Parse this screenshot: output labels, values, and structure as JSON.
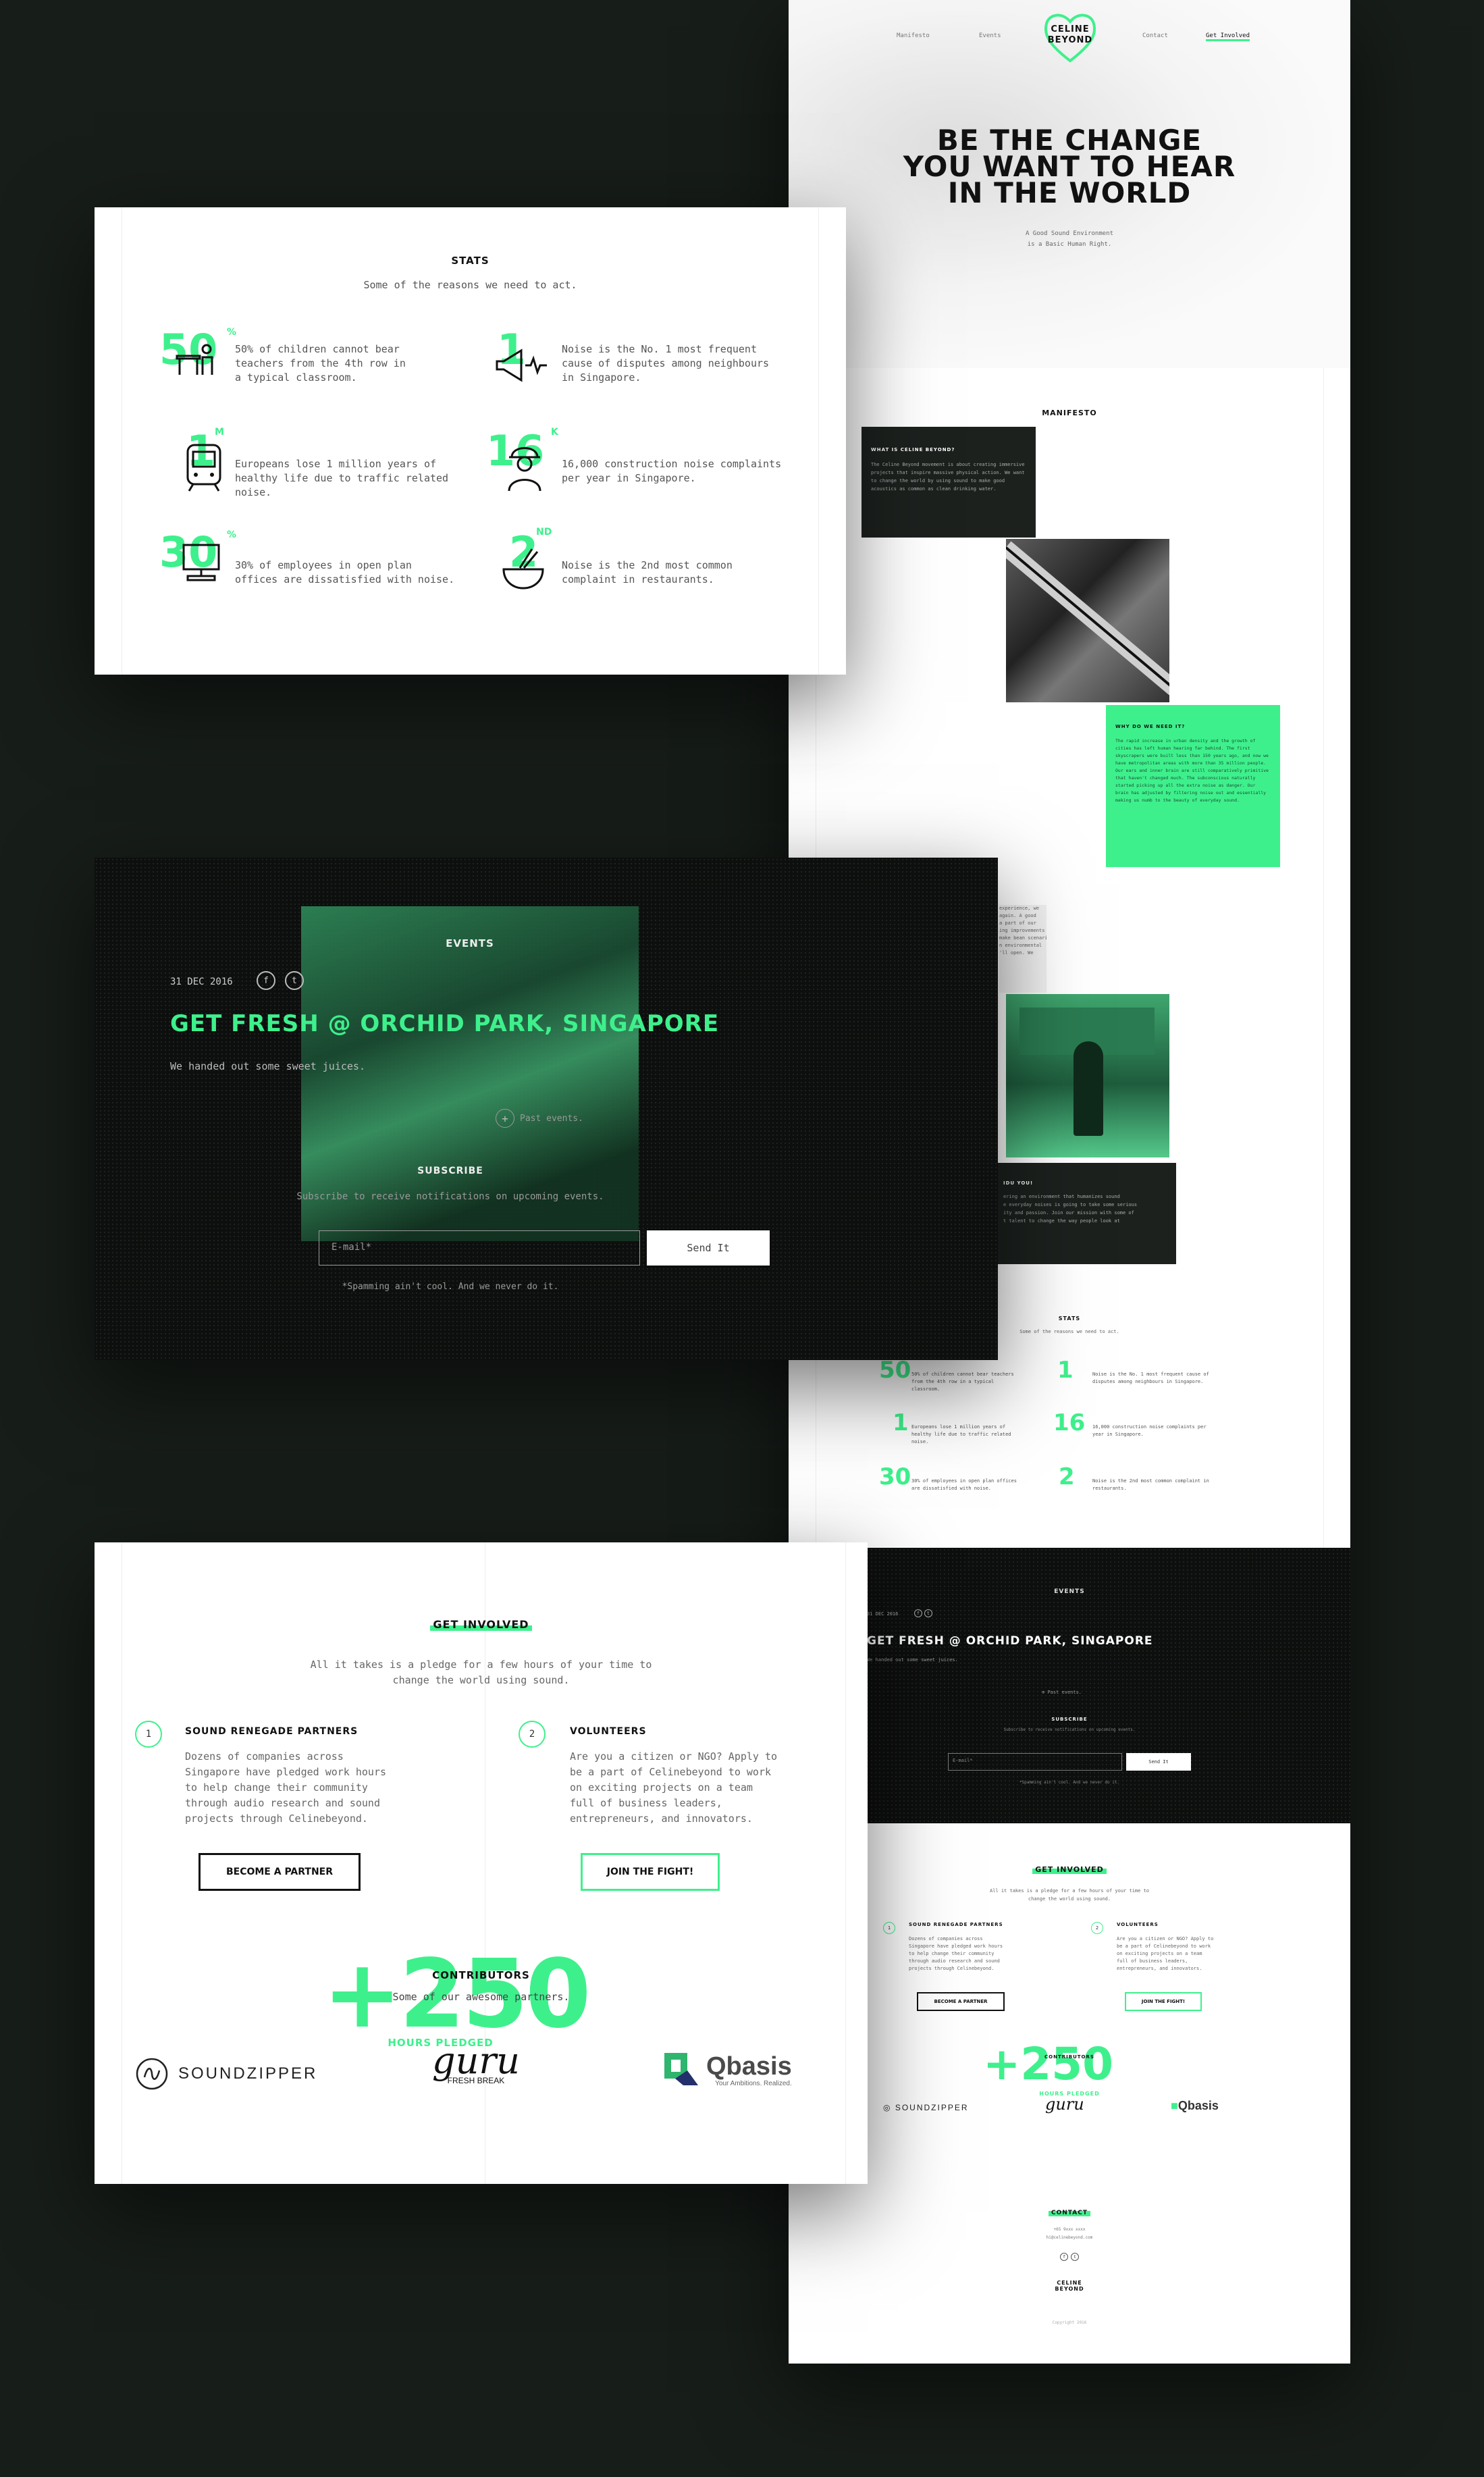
{
  "nav": {
    "links": [
      "Manifesto",
      "Events",
      "Contact",
      "Get Involved"
    ],
    "logo_line1": "CELINE",
    "logo_line2": "BEYOND"
  },
  "hero": {
    "title_lines": [
      "BE THE CHANGE",
      "YOU WANT TO HEAR",
      "IN THE WORLD"
    ],
    "subtitle_lines": [
      "A Good Sound Environment",
      "is a Basic Human Right."
    ]
  },
  "manifesto": {
    "title": "MANIFESTO",
    "what_title": "WHAT IS CELINE BEYOND?",
    "what_body": "The Celine Beyond movement is about creating immersive projects that inspire massive physical action. We want to change the world by using sound to make good acoustics as common as clean drinking water.",
    "why_title": "WHY DO WE NEED IT?",
    "why_body": "The rapid increase in urban density and the growth of cities has left human hearing far behind. The first skyscrapers were built less than 150 years ago, and now we have metropolitan areas with more than 35 million people. Our ears and inner brain are still comparatively primitive that haven't changed much. The subconscious naturally started picking up all the extra noise as danger. Our brain has adjusted by filtering noise out and essentially making us numb to the beauty of everyday sound.",
    "partial_body": "experience, we\nagain. A good\na part of our\ning improvements\nmake bean scenarios\nn environmental\n'll open. We",
    "you_title": "IDU YOU!",
    "you_body": "ering an environment that humanizes sound\ne everyday noises is going to take some serious\nity and passion. Join our mission with some of\nt talent to change the way people look at"
  },
  "stats": {
    "title": "STATS",
    "subtitle": "Some of the reasons we need to act.",
    "items": [
      {
        "num": "50",
        "sup": "%",
        "text": "50% of children cannot bear teachers from the 4th row in a typical classroom."
      },
      {
        "num": "1",
        "sup": "",
        "text": "Noise is the No. 1 most frequent cause of disputes among neighbours in Singapore."
      },
      {
        "num": "1",
        "sup": "M",
        "text": "Europeans lose 1 million years of healthy life due to traffic related noise."
      },
      {
        "num": "16",
        "sup": "K",
        "text": "16,000 construction noise complaints per year in Singapore."
      },
      {
        "num": "30",
        "sup": "%",
        "text": "30% of employees in open plan offices are dissatisfied with noise."
      },
      {
        "num": "2",
        "sup": "ND",
        "text": "Noise is the 2nd most common complaint in restaurants."
      }
    ]
  },
  "events": {
    "title": "EVENTS",
    "date": "31 DEC 2016",
    "headline": "GET FRESH @ ORCHID PARK, SINGAPORE",
    "desc": "We handed out some sweet juices.",
    "past_label": "Past events."
  },
  "subscribe": {
    "title": "SUBSCRIBE",
    "subtitle": "Subscribe to receive notifications on upcoming events.",
    "email_placeholder": "E-mail*",
    "button": "Send It",
    "note": "*Spamming ain't cool. And we never do it."
  },
  "involved": {
    "title": "GET INVOLVED",
    "subtitle_lines": [
      "All it takes is a pledge for a few hours of your time to",
      "change the world using sound."
    ],
    "partners": {
      "num": "1",
      "title": "SOUND RENEGADE PARTNERS",
      "body_lines": [
        "Dozens of companies across",
        "Singapore have pledged work hours",
        "to help change their community",
        "through audio research and sound",
        "projects through Celinebeyond."
      ],
      "button": "BECOME A PARTNER"
    },
    "volunteers": {
      "num": "2",
      "title": "VOLUNTEERS",
      "body_lines": [
        "Are you a citizen or NGO? Apply to",
        "be a part of Celinebeyond to work",
        "on exciting projects on a team",
        "full of business leaders,",
        "entrepreneurs, and innovators."
      ],
      "button": "JOIN THE FIGHT!"
    }
  },
  "contributors": {
    "big": "+250",
    "title": "CONTRIBUTORS",
    "subtitle": "Some of our awesome partners.",
    "pledged": "HOURS PLEDGED",
    "logos": {
      "soundzipper": "SOUNDZIPPER",
      "guru": "guru",
      "guru_sub": "FRESH BREAK",
      "qbasis": "Qbasis",
      "qbasis_sub": "Your Ambitions. Realized."
    }
  },
  "contact": {
    "title": "CONTACT",
    "phone": "+65 9xxx xxxx",
    "email": "hi@celinebeyond.com",
    "copyright": "Copyright 2016"
  },
  "colors": {
    "accent": "#3ef08c",
    "dark": "#171d19",
    "ink": "#111111"
  }
}
